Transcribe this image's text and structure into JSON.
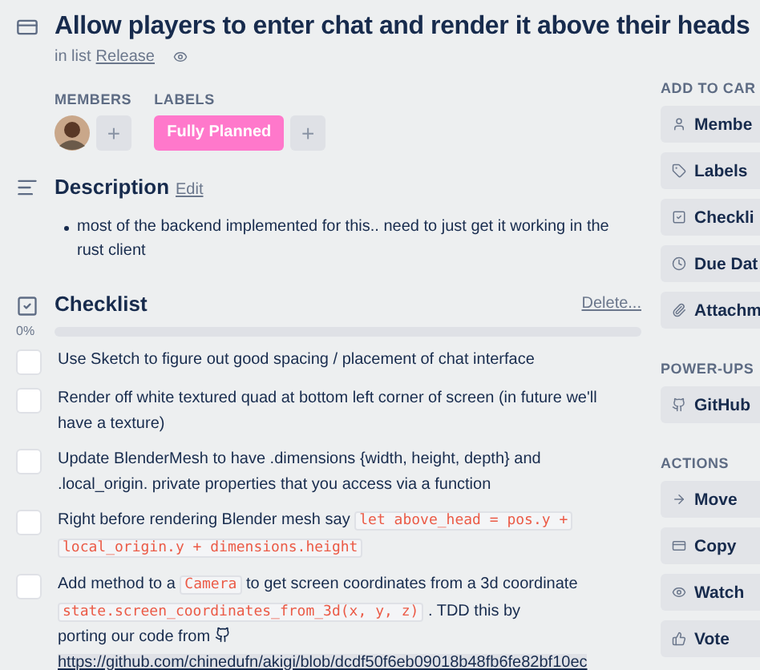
{
  "card": {
    "title": "Allow players to enter chat and render it above their heads",
    "list_prefix": "in list",
    "list_name": "Release"
  },
  "members": {
    "heading": "MEMBERS",
    "add": "+"
  },
  "labels": {
    "heading": "LABELS",
    "items": [
      {
        "text": "Fully Planned",
        "color": "#ff78cb"
      }
    ],
    "add": "+"
  },
  "description": {
    "heading": "Description",
    "edit": "Edit",
    "bullets": [
      "most of the backend implemented for this.. need to just get it working in the rust client"
    ]
  },
  "checklist": {
    "heading": "Checklist",
    "delete": "Delete...",
    "percent": "0%",
    "items": [
      {
        "checked": false,
        "parts": [
          {
            "kind": "text",
            "text": "Use Sketch to figure out good spacing / placement of chat interface"
          }
        ]
      },
      {
        "checked": false,
        "parts": [
          {
            "kind": "text",
            "text": "Render off white textured quad at bottom left corner of screen (in future we'll have a texture)"
          }
        ]
      },
      {
        "checked": false,
        "parts": [
          {
            "kind": "text",
            "text": "Update BlenderMesh to have .dimensions {width, height, depth} and .local_origin. private properties that you access via a function"
          }
        ]
      },
      {
        "checked": false,
        "parts": [
          {
            "kind": "text",
            "text": "Right before rendering Blender mesh say"
          },
          {
            "kind": "code",
            "text": "let above_head = pos.y +"
          },
          {
            "kind": "code",
            "text": "local_origin.y + dimensions.height"
          }
        ]
      },
      {
        "checked": false,
        "parts": [
          {
            "kind": "text",
            "text": "Add method to a"
          },
          {
            "kind": "code",
            "text": "Camera"
          },
          {
            "kind": "text",
            "text": "to get screen coordinates from a 3d coordinate"
          },
          {
            "kind": "code",
            "text": "state.screen_coordinates_from_3d(x, y, z)"
          },
          {
            "kind": "text",
            "text": ". TDD this by"
          },
          {
            "kind": "text",
            "text": "porting our code from"
          },
          {
            "kind": "github"
          },
          {
            "kind": "link",
            "text": "https://github.com/chinedufn/akigi/blob/dcdf50f6eb09018b48fb6fe82bf10ec"
          }
        ]
      }
    ]
  },
  "sidebar": [
    {
      "heading": "ADD TO CAR",
      "buttons": [
        {
          "text": "Membe"
        },
        {
          "text": "Labels"
        },
        {
          "text": "Checkli"
        },
        {
          "text": "Due Dat"
        },
        {
          "text": "Attachm"
        }
      ]
    },
    {
      "heading": "POWER-UPS",
      "buttons": [
        {
          "text": "GitHub"
        }
      ]
    },
    {
      "heading": "ACTIONS",
      "buttons": [
        {
          "text": "Move"
        },
        {
          "text": "Copy"
        },
        {
          "text": "Watch"
        },
        {
          "text": "Vote"
        }
      ]
    }
  ]
}
